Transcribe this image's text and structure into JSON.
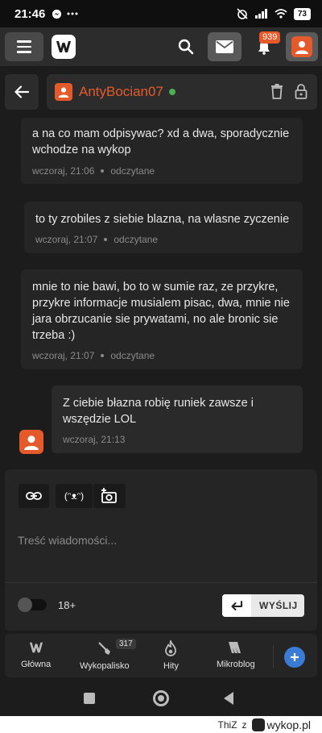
{
  "status_bar": {
    "time": "21:46",
    "notif_icons": [
      "messenger-icon",
      "more-icon"
    ],
    "battery": "73"
  },
  "app_bar": {
    "notifications_count": "939"
  },
  "conversation": {
    "username": "AntyBocian07",
    "online": true
  },
  "messages": [
    {
      "text": "a na co mam odpisywac? xd a dwa, sporadycznie wchodze na wykop",
      "time": "wczoraj, 21:06",
      "status": "odczytane",
      "mine": false
    },
    {
      "text": "to ty zrobiles z siebie blazna, na wlasne zyczenie",
      "time": "wczoraj, 21:07",
      "status": "odczytane",
      "mine": false
    },
    {
      "text": "mnie to nie bawi, bo to w sumie raz, ze przykre, przykre informacje musialem pisac, dwa, mnie nie jara obrzucanie sie prywatami, no ale bronic sie trzeba :)",
      "time": "wczoraj, 21:07",
      "status": "odczytane",
      "mine": false
    },
    {
      "text": "Z ciebie błazna robię runiek zawsze i wszędzie LOL",
      "time": "wczoraj, 21:13",
      "status": "",
      "mine": true
    }
  ],
  "composer": {
    "emoticon_label": "(ᵔᴥᵔ)",
    "placeholder": "Treść wiadomości...",
    "age_label": "18+",
    "send_label": "WYŚLIJ"
  },
  "bottom_nav": {
    "items": [
      {
        "label": "Główna",
        "icon": "home-icon"
      },
      {
        "label": "Wykopalisko",
        "icon": "shovel-icon",
        "badge": "317"
      },
      {
        "label": "Hity",
        "icon": "flame-icon"
      },
      {
        "label": "Mikroblog",
        "icon": "microblog-icon"
      }
    ]
  },
  "watermark": {
    "author": "ThiZ",
    "prefix": "z",
    "site": "wykop.pl"
  },
  "colors": {
    "accent": "#e55a2b",
    "online": "#4caf50",
    "fab": "#3a7bd5"
  }
}
